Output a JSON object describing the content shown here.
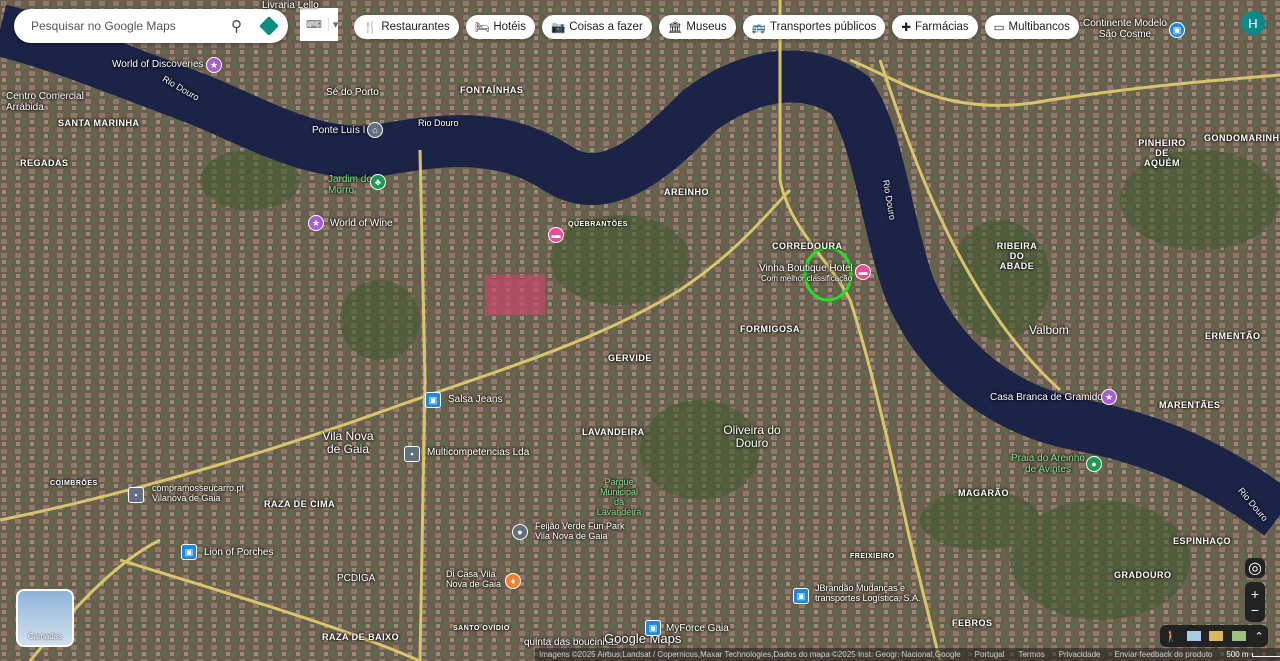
{
  "search": {
    "placeholder": "Pesquisar no Google Maps"
  },
  "chips": [
    {
      "icon": "fork-knife-icon",
      "label": "Restaurantes"
    },
    {
      "icon": "bed-icon",
      "label": "Hotéis"
    },
    {
      "icon": "camera-icon",
      "label": "Coisas a fazer"
    },
    {
      "icon": "museum-icon",
      "label": "Museus"
    },
    {
      "icon": "bus-icon",
      "label": "Transportes públicos"
    },
    {
      "icon": "pharmacy-icon",
      "label": "Farmácias"
    },
    {
      "icon": "atm-icon",
      "label": "Multibancos"
    }
  ],
  "avatar": "H",
  "labels": {
    "world_discoveries": "World of Discoveries",
    "se_porto": "Sé do Porto",
    "fontainhas": "FONTAÍNHAS",
    "centro": "Centro Comercial Arrábida",
    "santa_marinha": "SANTA MARINHA",
    "ponte": "Ponte Luís I",
    "rio1": "Rio Douro",
    "rio2": "Rio Douro",
    "rio3": "Rio Douro",
    "rio4": "Rio Douro",
    "regadas": "REGADAS",
    "jardim": "Jardim do Morro",
    "world_wine": "World of Wine",
    "areinho": "AREINHO",
    "quebrantoes": "QUEBRANTÕES",
    "corredoura": "CORREDOURA",
    "hotel": "Vinha Boutique Hotel",
    "hotel_sub": "Com melhor classificação",
    "formigosa": "FORMIGOSA",
    "gervide": "GERVIDE",
    "salsa": "Salsa Jeans",
    "vng": "Vila Nova de Gaia",
    "multi": "Multicompetencias Lda",
    "lavandeira": "LAVANDEIRA",
    "oliveira": "Oliveira do Douro",
    "parque": "Parque Municipal da Lavandeira",
    "compra": "compramosseucarro.pt Vilanova de Gaia",
    "coimbroes": "COIMBRÕES",
    "raza_cima": "RAZA DE CIMA",
    "lion": "Lion of Porches",
    "feijao": "Feijão Verde Fun Park Vila Nova de Gaia",
    "pcdiga": "PCDIGA",
    "dicasa": "Di Casa Vila Nova de Gaia",
    "raza_baixo": "RAZA DE BAIXO",
    "santo_ovidio": "SANTO OVÍDIO",
    "quinta": "quinta das boucinhas",
    "myforce": "MyForce Gaia",
    "jbrandao": "JBrandão Mudanças e transportes Logística, S.A.",
    "freixieiro": "FREIXIEIRO",
    "febros": "FEBROS",
    "gradouro": "GRADOURO",
    "espinhaco": "ESPINHAÇO",
    "magarao": "MAGARÃO",
    "praia": "Praia do Areinho de Avintes",
    "marentes": "MARENTÃES",
    "casa_branca": "Casa Branca de Gramido",
    "valbom": "Valbom",
    "ermentao": "ERMENTÃO",
    "ribeira": "RIBEIRA DO ABADE",
    "pinheiro": "PINHEIRO DE AQUÉM",
    "gondomarinho": "GONDOMARINHO",
    "continente": "Continente Modelo São Cosme",
    "livraria": "Livraria Lello",
    "google": "Google Maps"
  },
  "layers_label": "Camadas",
  "footer": [
    "Imagens ©2025 Airbus,Landsat / Copernicus,Maxar Technologies,Dados do mapa ©2025 Inst. Geogr. Nacional,Google",
    "Portugal",
    "Termos",
    "Privacidade",
    "Enviar feedback do produto"
  ],
  "scale": "500 m",
  "colors": {
    "water": "#1b2347",
    "road": "#d8c46a",
    "highlight": "#22e022",
    "hotel_pin": "#e84c9b"
  }
}
